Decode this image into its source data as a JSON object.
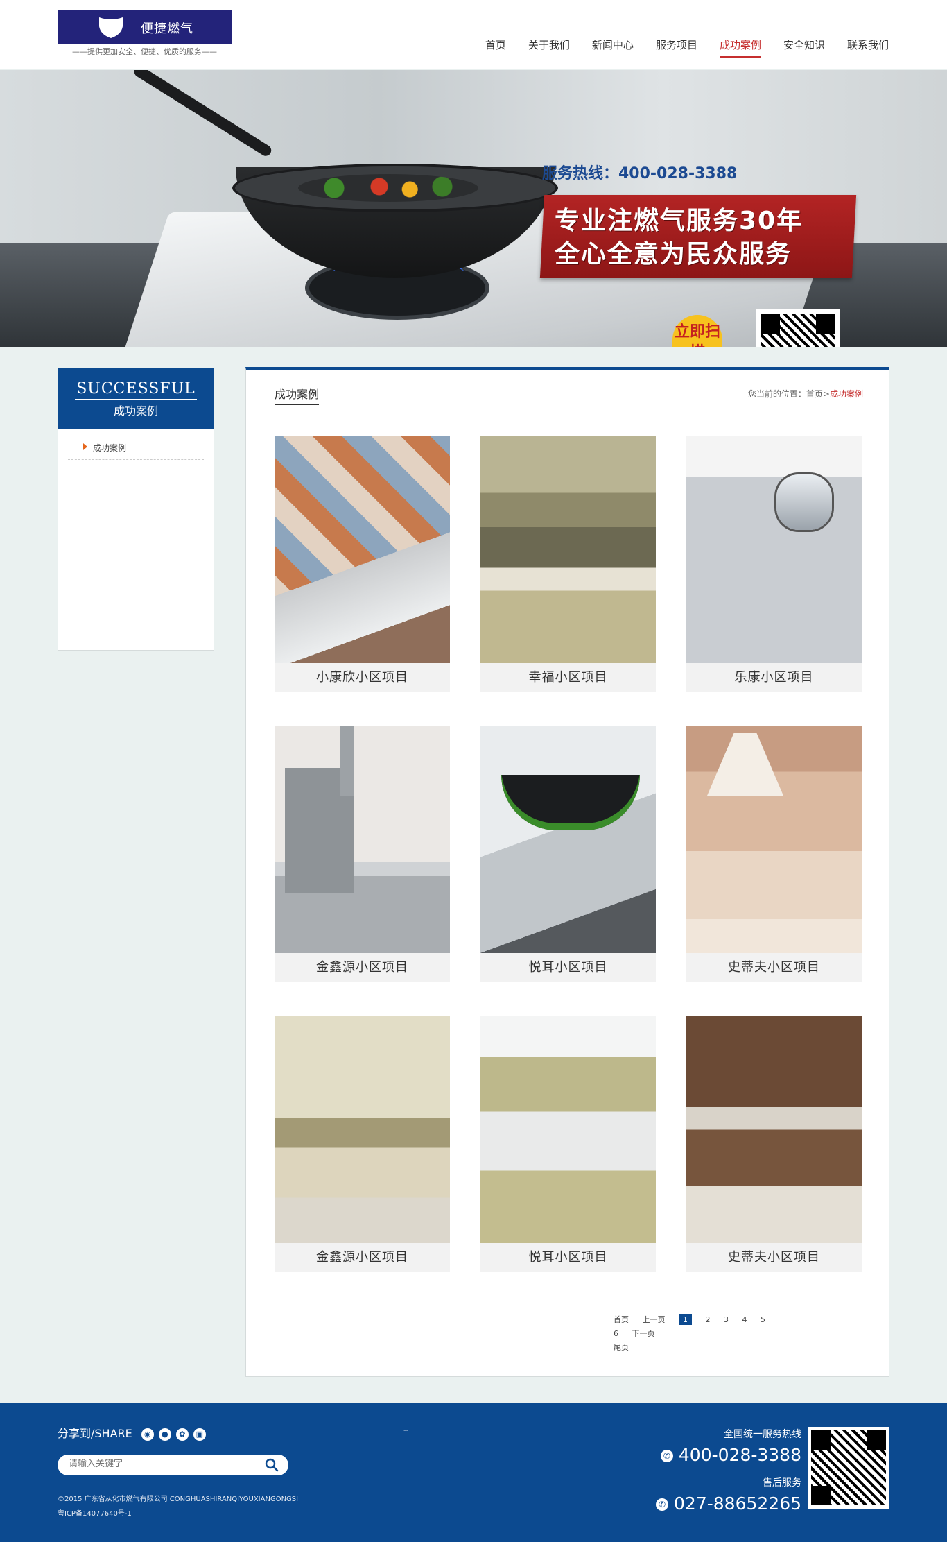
{
  "header": {
    "logo_text": "便捷燃气",
    "slogan": "——提供更加安全、便捷、优质的服务——",
    "nav": [
      "首页",
      "关于我们",
      "新闻中心",
      "服务项目",
      "成功案例",
      "安全知识",
      "联系我们"
    ],
    "active_nav": "成功案例"
  },
  "banner": {
    "hotline": "服务热线：400-028-3388",
    "slogan_line1": "专业注燃气服务30年",
    "slogan_line2": "全心全意为民众服务",
    "scan_label": "立即扫描"
  },
  "sidebar": {
    "title_en": "SUCCESSFUL",
    "title_cn": "成功案例",
    "items": [
      "成功案例"
    ]
  },
  "content": {
    "title": "成功案例",
    "breadcrumb_prefix": "您当前的位置：首页>",
    "breadcrumb_current": "成功案例",
    "cases": [
      {
        "caption": "小康欣小区项目"
      },
      {
        "caption": "幸福小区项目"
      },
      {
        "caption": "乐康小区项目"
      },
      {
        "caption": "金鑫源小区项目"
      },
      {
        "caption": "悦耳小区项目"
      },
      {
        "caption": "史蒂夫小区项目"
      },
      {
        "caption": "金鑫源小区项目"
      },
      {
        "caption": "悦耳小区项目"
      },
      {
        "caption": "史蒂夫小区项目"
      }
    ],
    "pager": {
      "first": "首页",
      "prev": "上一页",
      "pages": [
        "1",
        "2",
        "3",
        "4",
        "5",
        "6"
      ],
      "current": "1",
      "next": "下一页",
      "last": "尾页"
    }
  },
  "footer": {
    "share_label": "分享到/SHARE",
    "share_icons": [
      "weibo-icon",
      "qq-icon",
      "baidu-icon",
      "douban-icon"
    ],
    "search_placeholder": "请输入关键字",
    "dash": "--",
    "copyright": "©2015   广东省从化市燃气有限公司   CONGHUASHIRANQIYOUXIANGONGSI",
    "icp": "粤ICP备14077640号-1",
    "hotline_label": "全国统一服务热线",
    "hotline_number": "400-028-3388",
    "after_sales_label": "售后服务",
    "after_sales_number": "027-88652265"
  },
  "colors": {
    "brand_blue": "#0c4a90",
    "logo_navy": "#23237a",
    "accent_red": "#c62f2f"
  }
}
